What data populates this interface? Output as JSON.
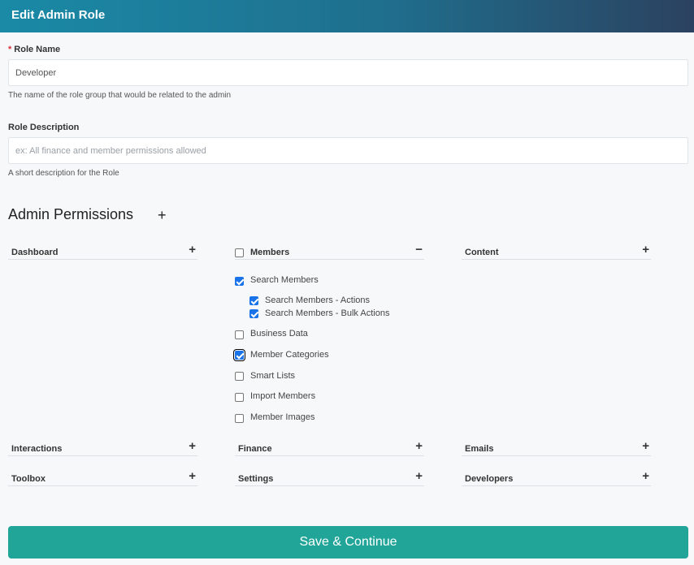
{
  "header": {
    "title": "Edit Admin Role"
  },
  "role_name": {
    "required_mark": "*",
    "label": "Role Name",
    "value": "Developer",
    "help": "The name of the role group that would be related to the admin"
  },
  "role_description": {
    "label": "Role Description",
    "value": "",
    "placeholder": "ex: All finance and member permissions allowed",
    "help": "A short description for the Role"
  },
  "permissions": {
    "title": "Admin Permissions",
    "add_symbol": "+",
    "expand_symbol": "+",
    "collapse_symbol": "−",
    "groups": {
      "dashboard": "Dashboard",
      "members": "Members",
      "content": "Content",
      "interactions": "Interactions",
      "finance": "Finance",
      "emails": "Emails",
      "toolbox": "Toolbox",
      "settings": "Settings",
      "developers": "Developers"
    },
    "members_items": {
      "search_members": {
        "label": "Search Members",
        "checked": true
      },
      "search_actions": {
        "label": "Search Members - Actions",
        "checked": true
      },
      "search_bulk": {
        "label": "Search Members - Bulk Actions",
        "checked": true
      },
      "business_data": {
        "label": "Business Data",
        "checked": false
      },
      "member_categories": {
        "label": "Member Categories",
        "checked": true
      },
      "smart_lists": {
        "label": "Smart Lists",
        "checked": false
      },
      "import_members": {
        "label": "Import Members",
        "checked": false
      },
      "member_images": {
        "label": "Member Images",
        "checked": false
      }
    }
  },
  "save_button": {
    "label": "Save & Continue"
  },
  "colors": {
    "header_start": "#1a8aa6",
    "header_end": "#2b4260",
    "save": "#21a598",
    "check": "#1a73e8"
  }
}
